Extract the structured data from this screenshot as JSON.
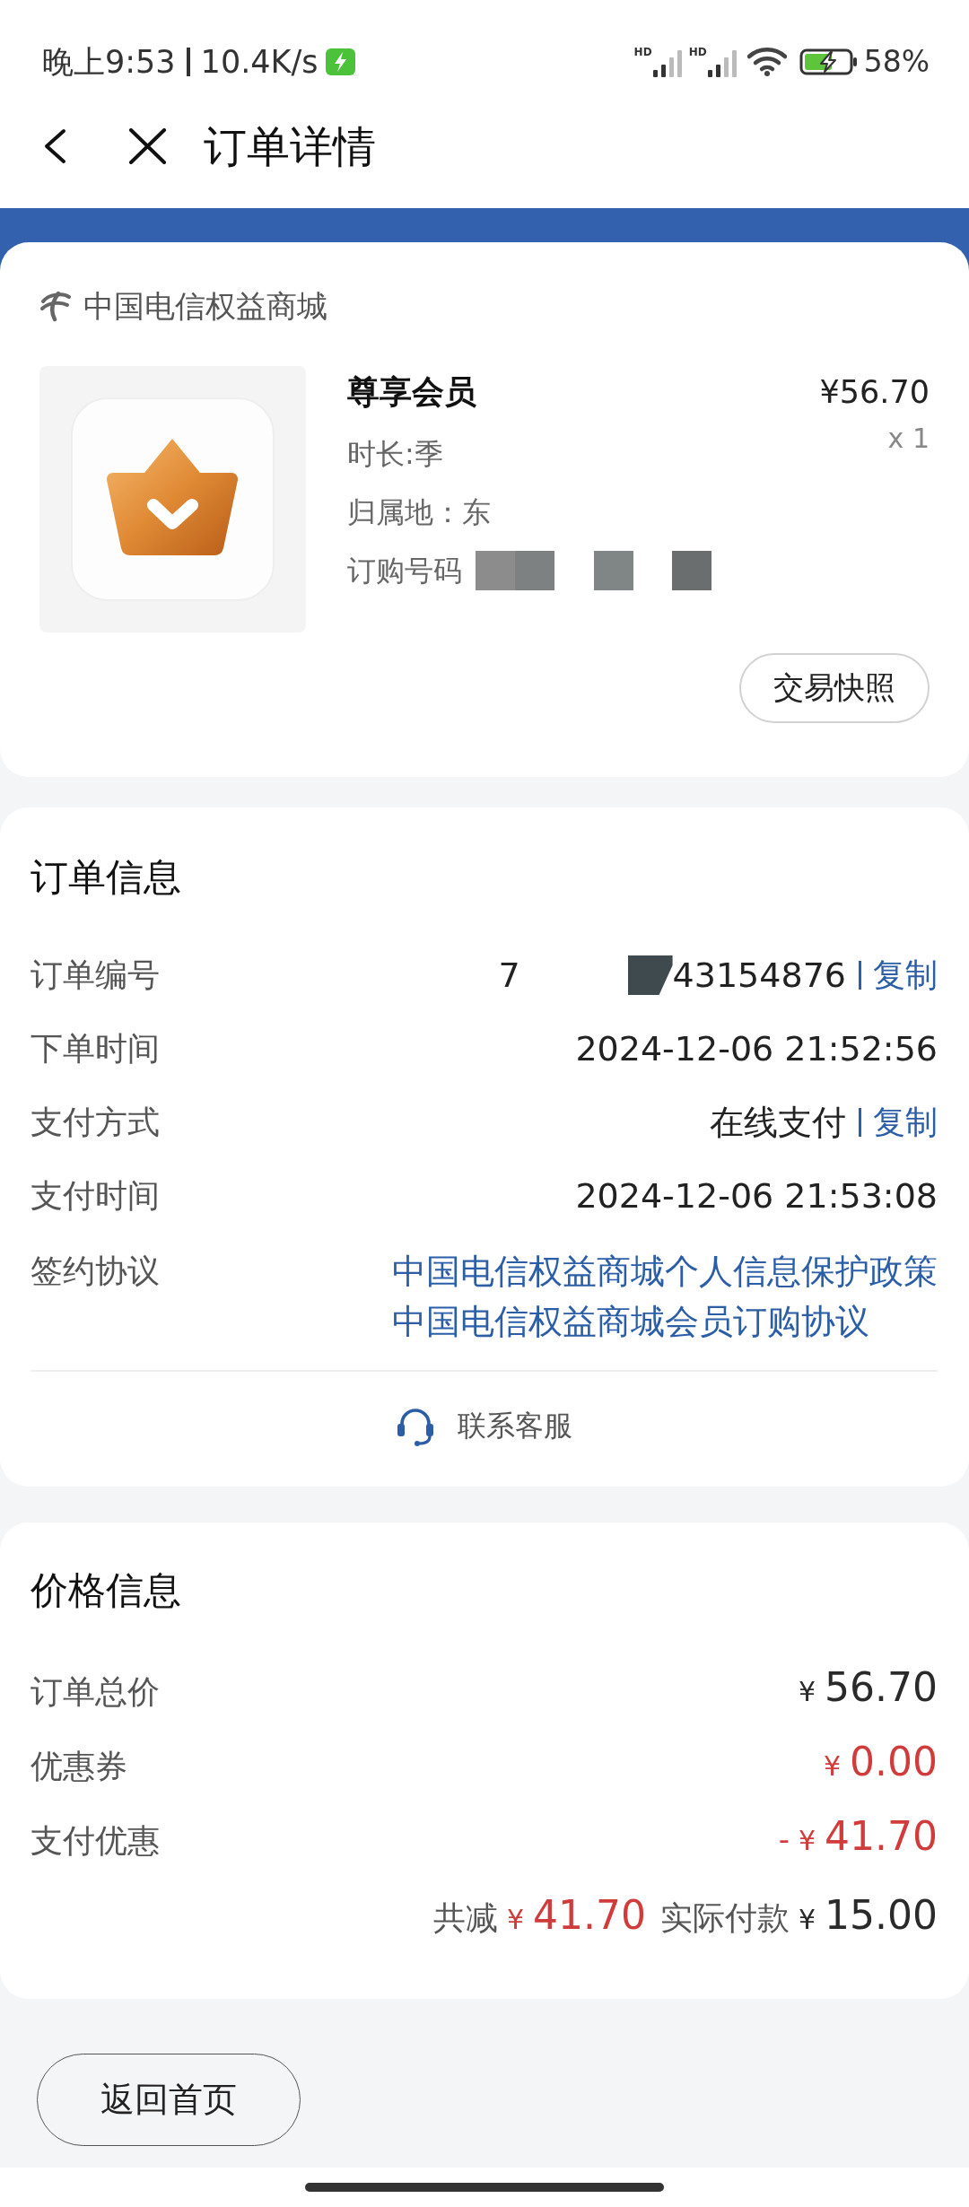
{
  "status_bar": {
    "time": "晚上9:53",
    "speed": "10.4K/s",
    "signals": [
      {
        "label": "HD"
      },
      {
        "label": "HD"
      }
    ],
    "battery": "58%"
  },
  "header": {
    "title": "订单详情"
  },
  "product_card": {
    "shop": "中国电信权益商城",
    "name": "尊享会员",
    "price": "¥56.70",
    "quantity": "x 1",
    "attributes": [
      {
        "text": "时长:季",
        "masked": false
      },
      {
        "text": "归属地：东",
        "masked": false
      },
      {
        "text": "订购号码",
        "masked": true
      }
    ],
    "snapshot_button": "交易快照"
  },
  "order_info": {
    "title": "订单信息",
    "rows": [
      {
        "label": "订单编号",
        "value_prefix": "7",
        "masked": true,
        "value": "43154876",
        "action": "复制"
      },
      {
        "label": "下单时间",
        "masked": false,
        "value": "2024-12-06 21:52:56"
      },
      {
        "label": "支付方式",
        "masked": false,
        "value": "在线支付",
        "action": "复制"
      },
      {
        "label": "支付时间",
        "masked": false,
        "value": "2024-12-06 21:53:08"
      }
    ],
    "agreement": {
      "label": "签约协议",
      "links": [
        "中国电信权益商城个人信息保护政策",
        "中国电信权益商城会员订购协议"
      ]
    },
    "service": "联系客服"
  },
  "price_info": {
    "title": "价格信息",
    "rows": [
      {
        "label": "订单总价",
        "currency": "¥",
        "amount": "56.70",
        "highlight": false
      },
      {
        "label": "优惠券",
        "currency": "¥",
        "amount": "0.00",
        "highlight": true
      },
      {
        "label": "支付优惠",
        "sign": "-",
        "currency": "¥",
        "amount": "41.70",
        "highlight": true
      }
    ],
    "summary": {
      "reduced_label": "共减",
      "reduced_currency": "¥",
      "reduced_amount": "41.70",
      "paid_label": "实际付款",
      "paid_currency": "¥",
      "paid_amount": "15.00"
    }
  },
  "footer": {
    "home_button": "返回首页"
  }
}
